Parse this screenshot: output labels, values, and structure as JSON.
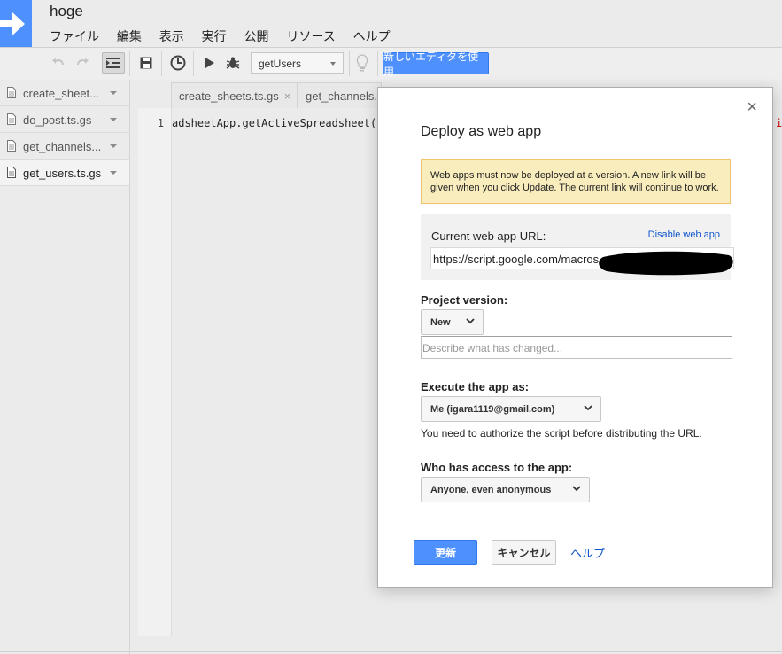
{
  "app": {
    "title": "hoge",
    "menu": [
      "ファイル",
      "編集",
      "表示",
      "実行",
      "公開",
      "リソース",
      "ヘルプ"
    ]
  },
  "toolbar": {
    "function_select": "getUsers",
    "new_editor_label": "新しいエディタを使用"
  },
  "files": [
    {
      "name": "create_sheet...",
      "active": false
    },
    {
      "name": "do_post.ts.gs",
      "active": false
    },
    {
      "name": "get_channels...",
      "active": false
    },
    {
      "name": "get_users.ts.gs",
      "active": true
    }
  ],
  "editor": {
    "tabs": [
      {
        "label": "create_sheets.ts.gs",
        "close": "×"
      },
      {
        "label": "get_channels.t",
        "close": ""
      }
    ],
    "line_number": "1",
    "code": "adsheetApp.getActiveSpreadsheet().",
    "code_tail": "i"
  },
  "dialog": {
    "close": "×",
    "title": "Deploy as web app",
    "notice": "Web apps must now be deployed at a version. A new link will be given when you click Update. The current link will continue to work.",
    "current_url_label": "Current web app URL:",
    "disable_link": "Disable web app",
    "url_value": "https://script.google.com/macros",
    "project_version_label": "Project version:",
    "project_version_value": "New",
    "describe_placeholder": "Describe what has changed...",
    "execute_as_label": "Execute the app as:",
    "execute_as_value": "Me (igara1119@gmail.com)",
    "auth_note": "You need to authorize the script before distributing the URL.",
    "access_label": "Who has access to the app:",
    "access_value": "Anyone, even anonymous",
    "update_button": "更新",
    "cancel_button": "キャンセル",
    "help_link": "ヘルプ"
  },
  "colors": {
    "accent": "#4d90fe",
    "notice_bg": "#f9edbe",
    "link": "#1155cc"
  }
}
